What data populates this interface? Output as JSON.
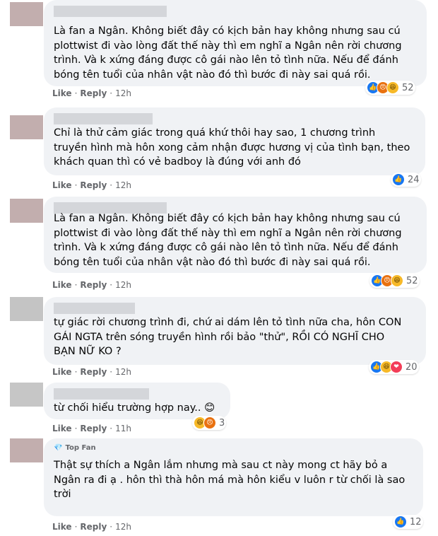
{
  "actions": {
    "like": "Like",
    "reply": "Reply",
    "dot": "·"
  },
  "comments": [
    {
      "badge": "",
      "lines": [
        "Là fan a Ngân. Không biết đây có kịch bản hay không nhưng sau cú",
        "plottwist đi vào lòng đất thế này thì em nghĩ a Ngân nên rời chương",
        "trình. Và k xứng đáng được cô gái nào lên tỏ tình nữa. Nếu để đánh",
        "bóng tên tuổi của nhân vật nào đó thì bước đi này sai quá rồi."
      ],
      "time": "12h",
      "reactions": [
        "like-icon",
        "angry-icon",
        "haha-icon"
      ],
      "reaction_count": "52"
    },
    {
      "badge": "",
      "lines": [
        "Chỉ là thử cảm giác trong quá khứ thôi hay sao, 1 chương trình",
        "truyền hình mà hôn xong cảm nhận được hương vị của tình bạn, theo",
        "khách quan thì có vẻ badboy là đúng với anh đó"
      ],
      "time": "12h",
      "reactions": [
        "like-icon"
      ],
      "reaction_count": "24"
    },
    {
      "badge": "",
      "lines": [
        "Là fan a Ngân. Không biết đây có kịch bản hay không nhưng sau cú",
        "plottwist đi vào lòng đất thế này thì em nghĩ a Ngân nên rời chương",
        "trình. Và k xứng đáng được cô gái nào lên tỏ tình nữa. Nếu để đánh",
        "bóng tên tuổi của nhân vật nào đó thì bước đi này sai quá rồi."
      ],
      "time": "12h",
      "reactions": [
        "like-icon",
        "angry-icon",
        "haha-icon"
      ],
      "reaction_count": "52"
    },
    {
      "badge": "",
      "lines": [
        "tự giác rời chương trình đi, chứ ai dám lên tỏ tình nữa cha, hôn CON",
        "GÁI NGTA trên sóng truyền hình rồi bảo \"thử\", RỒI CÓ NGHĨ CHO",
        "BẠN NỮ KO ?"
      ],
      "time": "12h",
      "reactions": [
        "like-icon",
        "haha-icon",
        "love-icon"
      ],
      "reaction_count": "20"
    },
    {
      "badge": "",
      "lines": [
        "từ chối hiểu trường hợp nay.. 😊"
      ],
      "time": "11h",
      "reactions": [
        "haha-icon",
        "angry-icon"
      ],
      "reaction_count": "3"
    },
    {
      "badge": "Top Fan",
      "lines": [
        "Thật sự thích a Ngân lắm nhưng mà sau ct này mong ct hãy bỏ a",
        "Ngân ra đi ạ . hôn thì thà hôn má mà hôn kiểu v luôn r từ chối là sao",
        "trời"
      ],
      "time": "12h",
      "reactions": [
        "like-icon"
      ],
      "reaction_count": "12"
    }
  ]
}
